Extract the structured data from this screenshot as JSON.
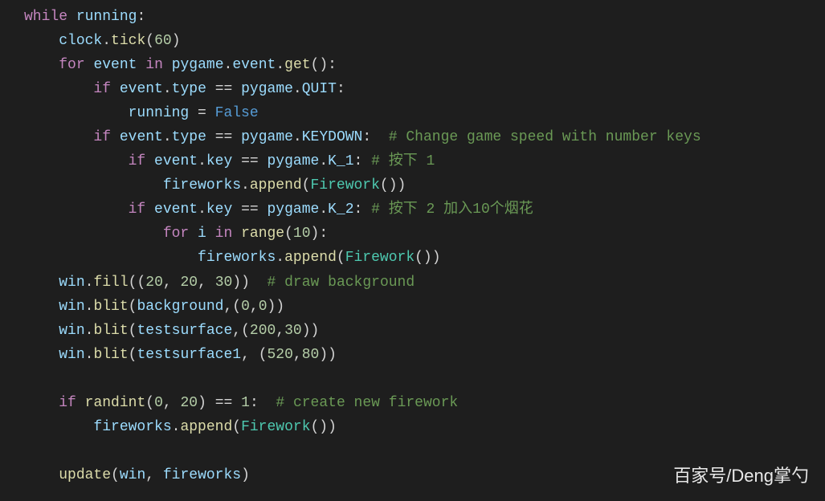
{
  "code": {
    "lines": [
      {
        "indent": 0,
        "tokens": [
          {
            "t": "keyword",
            "v": "while"
          },
          {
            "t": "punct",
            "v": " "
          },
          {
            "t": "variable",
            "v": "running"
          },
          {
            "t": "punct",
            "v": ":"
          }
        ]
      },
      {
        "indent": 1,
        "tokens": [
          {
            "t": "variable",
            "v": "clock"
          },
          {
            "t": "punct",
            "v": "."
          },
          {
            "t": "function",
            "v": "tick"
          },
          {
            "t": "punct",
            "v": "("
          },
          {
            "t": "number",
            "v": "60"
          },
          {
            "t": "punct",
            "v": ")"
          }
        ]
      },
      {
        "indent": 1,
        "tokens": [
          {
            "t": "keyword",
            "v": "for"
          },
          {
            "t": "punct",
            "v": " "
          },
          {
            "t": "variable",
            "v": "event"
          },
          {
            "t": "punct",
            "v": " "
          },
          {
            "t": "keyword",
            "v": "in"
          },
          {
            "t": "punct",
            "v": " "
          },
          {
            "t": "variable",
            "v": "pygame"
          },
          {
            "t": "punct",
            "v": "."
          },
          {
            "t": "variable",
            "v": "event"
          },
          {
            "t": "punct",
            "v": "."
          },
          {
            "t": "function",
            "v": "get"
          },
          {
            "t": "punct",
            "v": "():"
          }
        ]
      },
      {
        "indent": 2,
        "tokens": [
          {
            "t": "keyword",
            "v": "if"
          },
          {
            "t": "punct",
            "v": " "
          },
          {
            "t": "variable",
            "v": "event"
          },
          {
            "t": "punct",
            "v": "."
          },
          {
            "t": "variable",
            "v": "type"
          },
          {
            "t": "punct",
            "v": " == "
          },
          {
            "t": "variable",
            "v": "pygame"
          },
          {
            "t": "punct",
            "v": "."
          },
          {
            "t": "variable",
            "v": "QUIT"
          },
          {
            "t": "punct",
            "v": ":"
          }
        ]
      },
      {
        "indent": 3,
        "tokens": [
          {
            "t": "variable",
            "v": "running"
          },
          {
            "t": "punct",
            "v": " = "
          },
          {
            "t": "constant",
            "v": "False"
          }
        ]
      },
      {
        "indent": 2,
        "tokens": [
          {
            "t": "keyword",
            "v": "if"
          },
          {
            "t": "punct",
            "v": " "
          },
          {
            "t": "variable",
            "v": "event"
          },
          {
            "t": "punct",
            "v": "."
          },
          {
            "t": "variable",
            "v": "type"
          },
          {
            "t": "punct",
            "v": " == "
          },
          {
            "t": "variable",
            "v": "pygame"
          },
          {
            "t": "punct",
            "v": "."
          },
          {
            "t": "variable",
            "v": "KEYDOWN"
          },
          {
            "t": "punct",
            "v": ":  "
          },
          {
            "t": "comment",
            "v": "# Change game speed with number keys"
          }
        ]
      },
      {
        "indent": 3,
        "tokens": [
          {
            "t": "keyword",
            "v": "if"
          },
          {
            "t": "punct",
            "v": " "
          },
          {
            "t": "variable",
            "v": "event"
          },
          {
            "t": "punct",
            "v": "."
          },
          {
            "t": "variable",
            "v": "key"
          },
          {
            "t": "punct",
            "v": " == "
          },
          {
            "t": "variable",
            "v": "pygame"
          },
          {
            "t": "punct",
            "v": "."
          },
          {
            "t": "variable",
            "v": "K_1"
          },
          {
            "t": "punct",
            "v": ": "
          },
          {
            "t": "comment",
            "v": "# 按下 1"
          }
        ]
      },
      {
        "indent": 4,
        "tokens": [
          {
            "t": "variable",
            "v": "fireworks"
          },
          {
            "t": "punct",
            "v": "."
          },
          {
            "t": "function",
            "v": "append"
          },
          {
            "t": "punct",
            "v": "("
          },
          {
            "t": "class-name",
            "v": "Firework"
          },
          {
            "t": "punct",
            "v": "())"
          }
        ]
      },
      {
        "indent": 3,
        "tokens": [
          {
            "t": "keyword",
            "v": "if"
          },
          {
            "t": "punct",
            "v": " "
          },
          {
            "t": "variable",
            "v": "event"
          },
          {
            "t": "punct",
            "v": "."
          },
          {
            "t": "variable",
            "v": "key"
          },
          {
            "t": "punct",
            "v": " == "
          },
          {
            "t": "variable",
            "v": "pygame"
          },
          {
            "t": "punct",
            "v": "."
          },
          {
            "t": "variable",
            "v": "K_2"
          },
          {
            "t": "punct",
            "v": ": "
          },
          {
            "t": "comment",
            "v": "# 按下 2 加入10个烟花"
          }
        ]
      },
      {
        "indent": 4,
        "tokens": [
          {
            "t": "keyword",
            "v": "for"
          },
          {
            "t": "punct",
            "v": " "
          },
          {
            "t": "variable",
            "v": "i"
          },
          {
            "t": "punct",
            "v": " "
          },
          {
            "t": "keyword",
            "v": "in"
          },
          {
            "t": "punct",
            "v": " "
          },
          {
            "t": "function",
            "v": "range"
          },
          {
            "t": "punct",
            "v": "("
          },
          {
            "t": "number",
            "v": "10"
          },
          {
            "t": "punct",
            "v": "):"
          }
        ]
      },
      {
        "indent": 5,
        "tokens": [
          {
            "t": "variable",
            "v": "fireworks"
          },
          {
            "t": "punct",
            "v": "."
          },
          {
            "t": "function",
            "v": "append"
          },
          {
            "t": "punct",
            "v": "("
          },
          {
            "t": "class-name",
            "v": "Firework"
          },
          {
            "t": "punct",
            "v": "())"
          }
        ]
      },
      {
        "indent": 1,
        "tokens": [
          {
            "t": "variable",
            "v": "win"
          },
          {
            "t": "punct",
            "v": "."
          },
          {
            "t": "function",
            "v": "fill"
          },
          {
            "t": "punct",
            "v": "(("
          },
          {
            "t": "number",
            "v": "20"
          },
          {
            "t": "punct",
            "v": ", "
          },
          {
            "t": "number",
            "v": "20"
          },
          {
            "t": "punct",
            "v": ", "
          },
          {
            "t": "number",
            "v": "30"
          },
          {
            "t": "punct",
            "v": "))  "
          },
          {
            "t": "comment",
            "v": "# draw background"
          }
        ]
      },
      {
        "indent": 1,
        "tokens": [
          {
            "t": "variable",
            "v": "win"
          },
          {
            "t": "punct",
            "v": "."
          },
          {
            "t": "function",
            "v": "blit"
          },
          {
            "t": "punct",
            "v": "("
          },
          {
            "t": "variable",
            "v": "background"
          },
          {
            "t": "punct",
            "v": ",("
          },
          {
            "t": "number",
            "v": "0"
          },
          {
            "t": "punct",
            "v": ","
          },
          {
            "t": "number",
            "v": "0"
          },
          {
            "t": "punct",
            "v": "))"
          }
        ]
      },
      {
        "indent": 1,
        "tokens": [
          {
            "t": "variable",
            "v": "win"
          },
          {
            "t": "punct",
            "v": "."
          },
          {
            "t": "function",
            "v": "blit"
          },
          {
            "t": "punct",
            "v": "("
          },
          {
            "t": "variable",
            "v": "testsurface"
          },
          {
            "t": "punct",
            "v": ",("
          },
          {
            "t": "number",
            "v": "200"
          },
          {
            "t": "punct",
            "v": ","
          },
          {
            "t": "number",
            "v": "30"
          },
          {
            "t": "punct",
            "v": "))"
          }
        ]
      },
      {
        "indent": 1,
        "tokens": [
          {
            "t": "variable",
            "v": "win"
          },
          {
            "t": "punct",
            "v": "."
          },
          {
            "t": "function",
            "v": "blit"
          },
          {
            "t": "punct",
            "v": "("
          },
          {
            "t": "variable",
            "v": "testsurface1"
          },
          {
            "t": "punct",
            "v": ", ("
          },
          {
            "t": "number",
            "v": "520"
          },
          {
            "t": "punct",
            "v": ","
          },
          {
            "t": "number",
            "v": "80"
          },
          {
            "t": "punct",
            "v": "))"
          }
        ]
      },
      {
        "indent": 0,
        "tokens": []
      },
      {
        "indent": 1,
        "tokens": [
          {
            "t": "keyword",
            "v": "if"
          },
          {
            "t": "punct",
            "v": " "
          },
          {
            "t": "function",
            "v": "randint"
          },
          {
            "t": "punct",
            "v": "("
          },
          {
            "t": "number",
            "v": "0"
          },
          {
            "t": "punct",
            "v": ", "
          },
          {
            "t": "number",
            "v": "20"
          },
          {
            "t": "punct",
            "v": ") == "
          },
          {
            "t": "number",
            "v": "1"
          },
          {
            "t": "punct",
            "v": ":  "
          },
          {
            "t": "comment",
            "v": "# create new firework"
          }
        ]
      },
      {
        "indent": 2,
        "tokens": [
          {
            "t": "variable",
            "v": "fireworks"
          },
          {
            "t": "punct",
            "v": "."
          },
          {
            "t": "function",
            "v": "append"
          },
          {
            "t": "punct",
            "v": "("
          },
          {
            "t": "class-name",
            "v": "Firework"
          },
          {
            "t": "punct",
            "v": "())"
          }
        ]
      },
      {
        "indent": 0,
        "tokens": []
      },
      {
        "indent": 1,
        "tokens": [
          {
            "t": "function",
            "v": "update"
          },
          {
            "t": "punct",
            "v": "("
          },
          {
            "t": "variable",
            "v": "win"
          },
          {
            "t": "punct",
            "v": ", "
          },
          {
            "t": "variable",
            "v": "fireworks"
          },
          {
            "t": "punct",
            "v": ")"
          }
        ]
      }
    ]
  },
  "watermark": "百家号/Deng掌勺",
  "indent_size": "    "
}
